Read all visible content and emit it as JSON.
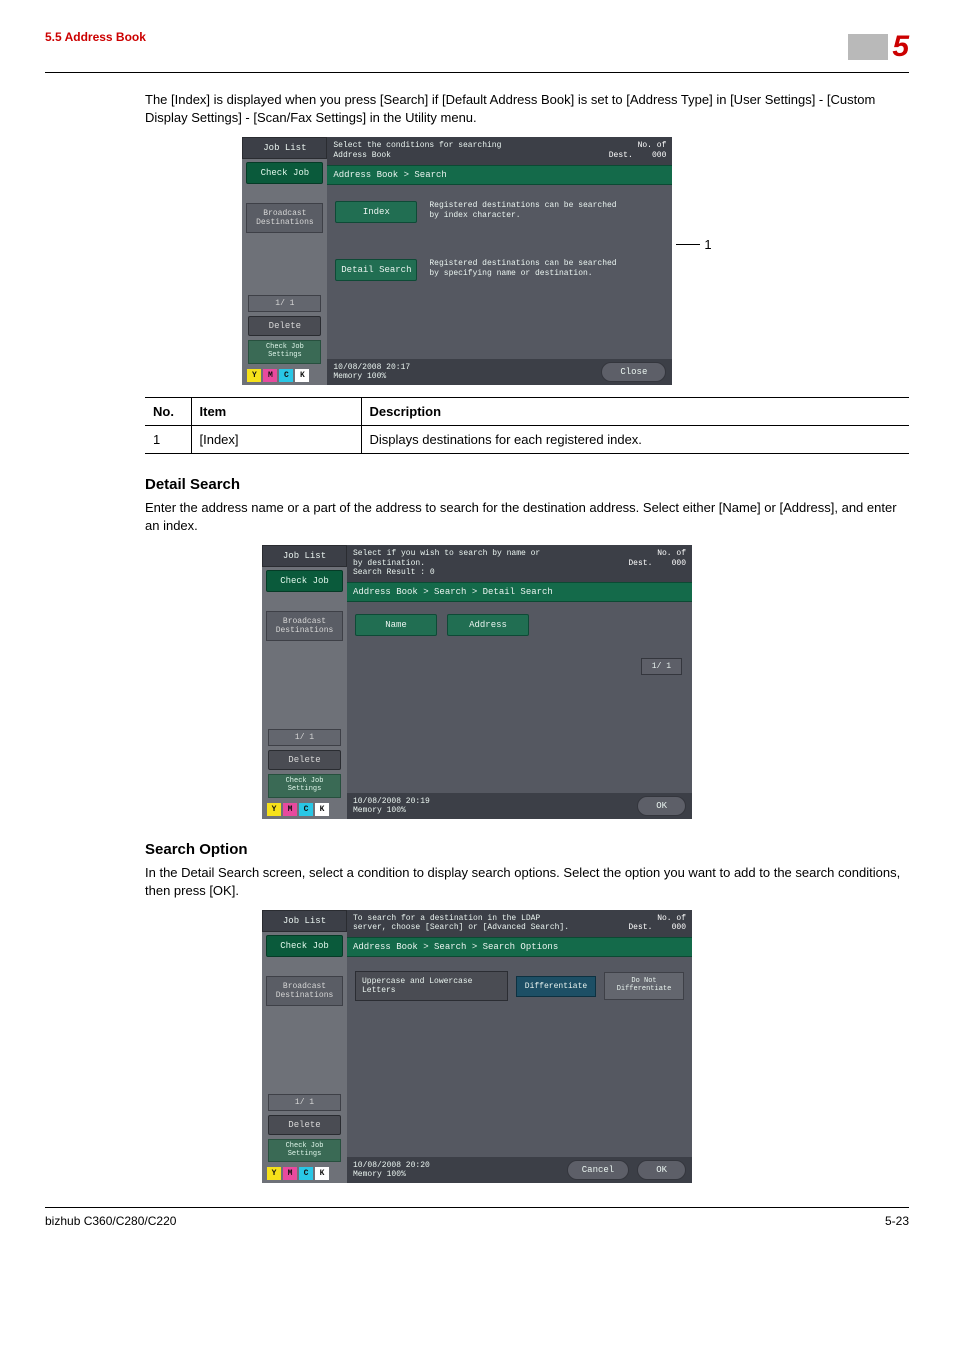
{
  "page_header": {
    "section": "5.5    Address Book",
    "chapter": "5"
  },
  "intro1": "The [Index] is displayed when you press [Search] if [Default Address Book] is set to [Address Type] in [User Settings] - [Custom Display Settings] - [Scan/Fax Settings] in the Utility menu.",
  "callout1": "1",
  "screen1": {
    "left": {
      "joblist": "Job List",
      "checkjob": "Check Job",
      "broadcast": "Broadcast\nDestinations",
      "pager": "1/   1",
      "delete": "Delete",
      "checkjobset": "Check Job\nSettings"
    },
    "hdr_msg": "Select the conditions for searching\nAddress Book",
    "nodest_lbl": "No. of\nDest.",
    "nodest_count": "000",
    "crumb": "Address Book > Search",
    "info1": "Registered destinations can be searched\nby index character.",
    "btn_index": "Index",
    "info2": "Registered destinations can be searched\nby specifying name or destination.",
    "btn_detail": "Detail Search",
    "foot_date": "10/08/2008    20:17",
    "foot_mem": "Memory        100%",
    "btn_close": "Close"
  },
  "table1": {
    "h_no": "No.",
    "h_item": "Item",
    "h_desc": "Description",
    "r1_no": "1",
    "r1_item": "[Index]",
    "r1_desc": "Displays destinations for each registered index."
  },
  "detail": {
    "heading": "Detail Search",
    "para": "Enter the address name or a part of the address to search for the destination address. Select either [Name] or [Address], and enter an index."
  },
  "screen2": {
    "hdr_msg": "Select if you wish to search by name or\nby destination.\n        Search Result  :    0",
    "crumb": "Address Book > Search > Detail Search",
    "btn_name": "Name",
    "btn_addr": "Address",
    "pager_right": "1/   1",
    "foot_date": "10/08/2008    20:19",
    "foot_mem": "Memory        100%",
    "btn_ok": "OK"
  },
  "searchopt": {
    "heading": "Search Option",
    "para": "In the Detail Search screen, select a condition to display search options. Select the option you want to add to the search conditions, then press [OK]."
  },
  "screen3": {
    "hdr_msg": "To search for a destination in the LDAP\nserver, choose [Search] or [Advanced Search].",
    "crumb": "Address Book > Search > Search Options",
    "opt_label": "Uppercase and Lowercase Letters",
    "opt_diff": "Differentiate",
    "opt_donot": "Do Not\nDifferentiate",
    "foot_date": "10/08/2008    20:20",
    "foot_mem": "Memory        100%",
    "btn_cancel": "Cancel",
    "btn_ok": "OK"
  },
  "page_footer": {
    "model": "bizhub C360/C280/C220",
    "pg": "5-23"
  }
}
